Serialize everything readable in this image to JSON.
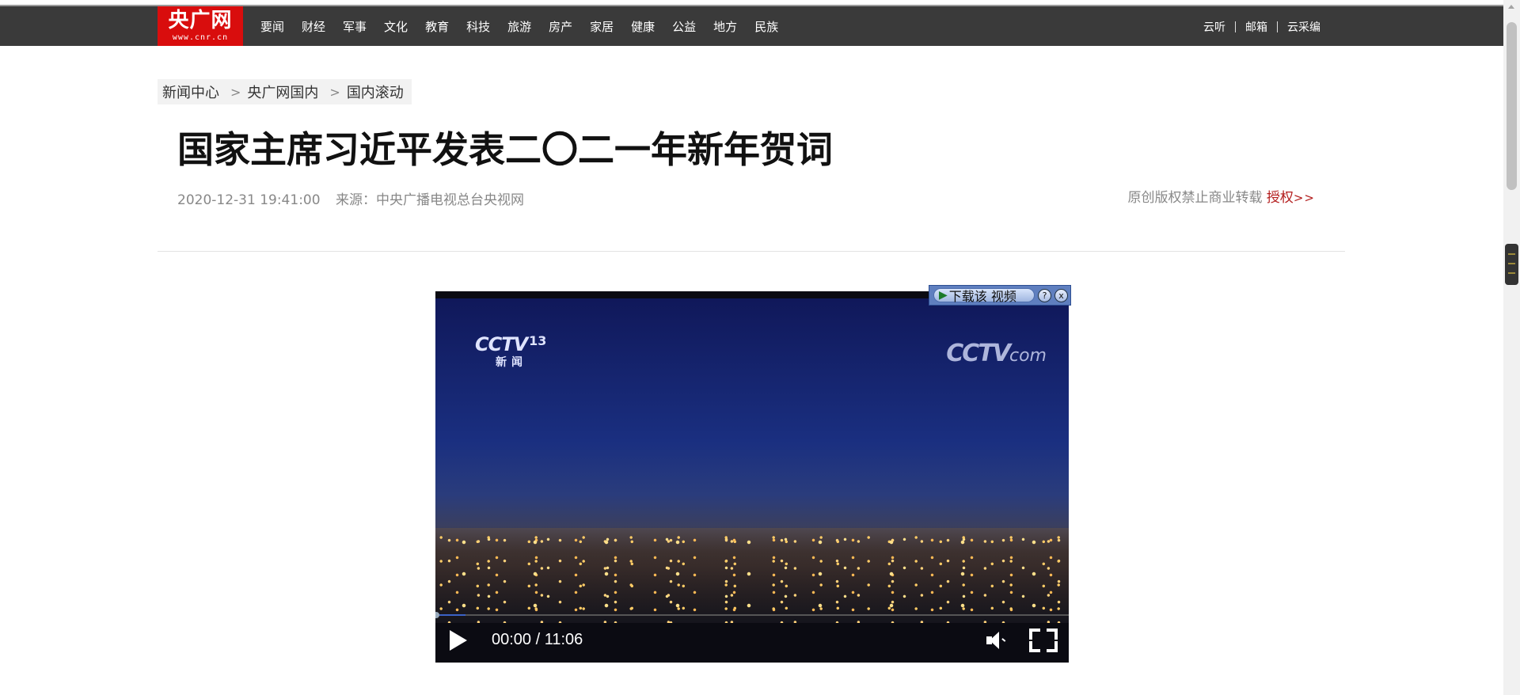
{
  "nav": {
    "logo_text": "央广网",
    "logo_url": "www.cnr.cn",
    "items": [
      "要闻",
      "财经",
      "军事",
      "文化",
      "教育",
      "科技",
      "旅游",
      "房产",
      "家居",
      "健康",
      "公益",
      "地方",
      "民族"
    ],
    "right_items": [
      "云听",
      "邮箱",
      "云采编"
    ]
  },
  "breadcrumb": {
    "items": [
      "新闻中心",
      "央广网国内",
      "国内滚动"
    ],
    "separator": ">"
  },
  "article": {
    "title": "国家主席习近平发表二〇二一年新年贺词",
    "datetime": "2020-12-31 19:41:00",
    "source": "来源：中央广播电视总台央视网",
    "rights_text": "原创版权禁止商业转载",
    "rights_link": "授权",
    "rights_arrows": ">>"
  },
  "video": {
    "download_label": "下载该 视频",
    "help_label": "?",
    "close_label": "x",
    "channel_logo": "CCTV",
    "channel_number": "13",
    "channel_sub": "新闻",
    "watermark": "CCTV",
    "watermark_suffix": "com",
    "time_display": "00:00 / 11:06",
    "progress_fraction": 0.048,
    "is_playing": false
  },
  "colors": {
    "nav_bg": "#3a3a3a",
    "logo_bg": "#d90d0d",
    "link_red": "#b31d1d"
  }
}
